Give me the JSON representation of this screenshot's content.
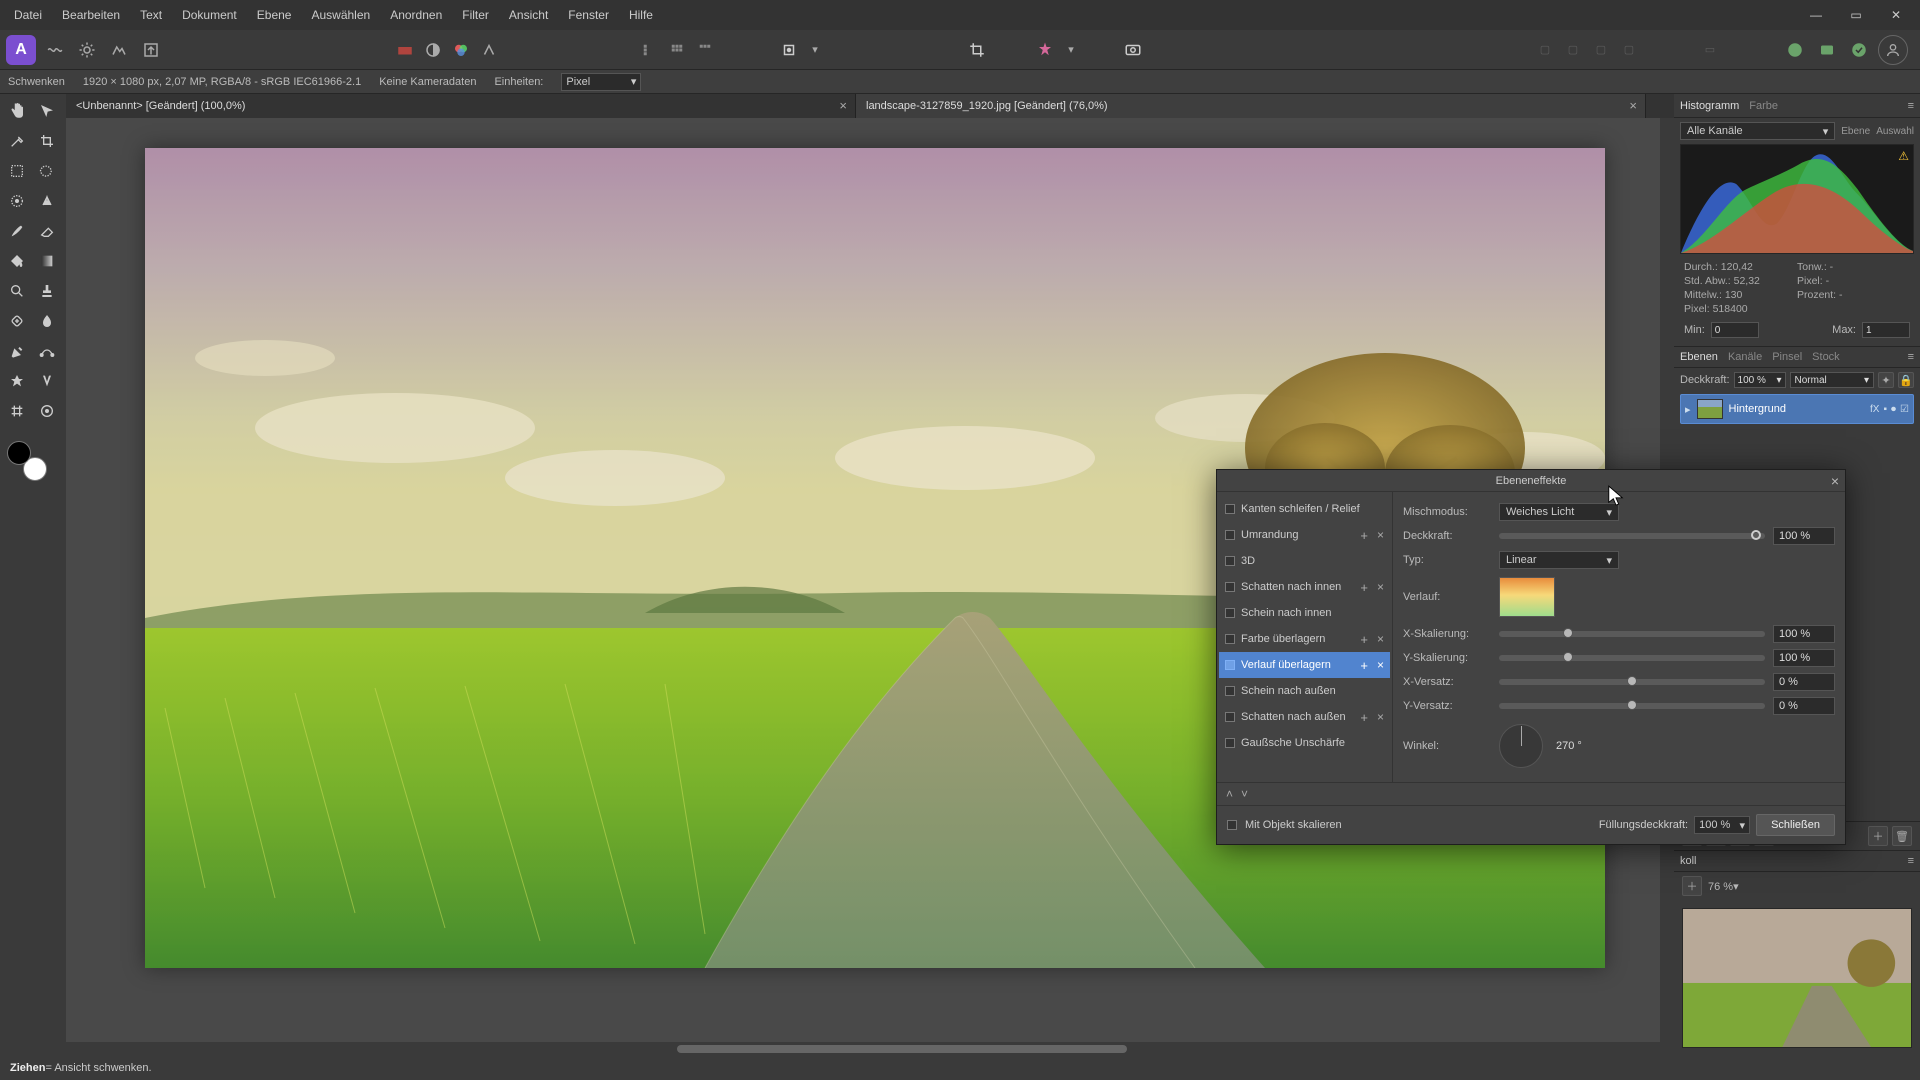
{
  "menu": [
    "Datei",
    "Bearbeiten",
    "Text",
    "Dokument",
    "Ebene",
    "Auswählen",
    "Anordnen",
    "Filter",
    "Ansicht",
    "Fenster",
    "Hilfe"
  ],
  "infobar": {
    "mode": "Schwenken",
    "dims": "1920 × 1080 px, 2,07 MP, RGBA/8 - sRGB IEC61966-2.1",
    "camera": "Keine Kameradaten",
    "units_label": "Einheiten:",
    "units_value": "Pixel"
  },
  "tabs": [
    {
      "title": "<Unbenannt> [Geändert] (100,0%)",
      "active": false
    },
    {
      "title": "landscape-3127859_1920.jpg [Geändert] (76,0%)",
      "active": true
    }
  ],
  "hist_panel": {
    "tabs": [
      "Histogramm",
      "Farbe"
    ],
    "channel": "Alle Kanäle",
    "btns": [
      "Ebene",
      "Auswahl"
    ],
    "stats": {
      "durch": "Durch.: 120,42",
      "tonw": "Tonw.: -",
      "std": "Std. Abw.: 52,32",
      "pixelr": "Pixel: -",
      "mittelw": "Mittelw.: 130",
      "proz": "Prozent: -",
      "pixel": "Pixel: 518400"
    },
    "min_label": "Min:",
    "min": "0",
    "max_label": "Max:",
    "max": "1"
  },
  "layers_panel": {
    "tabs": [
      "Ebenen",
      "Kanäle",
      "Pinsel",
      "Stock"
    ],
    "opacity_label": "Deckkraft:",
    "opacity": "100 %",
    "blend": "Normal",
    "layer_name": "Hintergrund",
    "layer_fx": "fX"
  },
  "nav_panel": {
    "tab": "koll",
    "zoom": "76 %"
  },
  "fx": {
    "title": "Ebeneneffekte",
    "list": [
      {
        "label": "Kanten schleifen / Relief",
        "chk": false,
        "plus": false,
        "x": false
      },
      {
        "label": "Umrandung",
        "chk": false,
        "plus": true,
        "x": true
      },
      {
        "label": "3D",
        "chk": false,
        "plus": false,
        "x": false
      },
      {
        "label": "Schatten nach innen",
        "chk": false,
        "plus": true,
        "x": true
      },
      {
        "label": "Schein nach innen",
        "chk": false,
        "plus": false,
        "x": false
      },
      {
        "label": "Farbe überlagern",
        "chk": false,
        "plus": true,
        "x": true
      },
      {
        "label": "Verlauf überlagern",
        "chk": true,
        "plus": true,
        "x": true,
        "sel": true
      },
      {
        "label": "Schein nach außen",
        "chk": false,
        "plus": false,
        "x": false
      },
      {
        "label": "Schatten nach außen",
        "chk": false,
        "plus": true,
        "x": true
      },
      {
        "label": "Gaußsche Unschärfe",
        "chk": false,
        "plus": false,
        "x": false
      }
    ],
    "props": {
      "mix_label": "Mischmodus:",
      "mix": "Weiches Licht",
      "op_label": "Deckkraft:",
      "op": "100 %",
      "typ_label": "Typ:",
      "typ": "Linear",
      "grad_label": "Verlauf:",
      "xscale_label": "X-Skalierung:",
      "xscale": "100 %",
      "yscale_label": "Y-Skalierung:",
      "yscale": "100 %",
      "xoff_label": "X-Versatz:",
      "xoff": "0 %",
      "yoff_label": "Y-Versatz:",
      "yoff": "0 %",
      "ang_label": "Winkel:",
      "ang": "270 °"
    },
    "scale_label": "Mit Objekt skalieren",
    "fill_label": "Füllungsdeckkraft:",
    "fill": "100 %",
    "close": "Schließen"
  },
  "status": {
    "key": "Ziehen",
    "rest": " = Ansicht schwenken."
  }
}
